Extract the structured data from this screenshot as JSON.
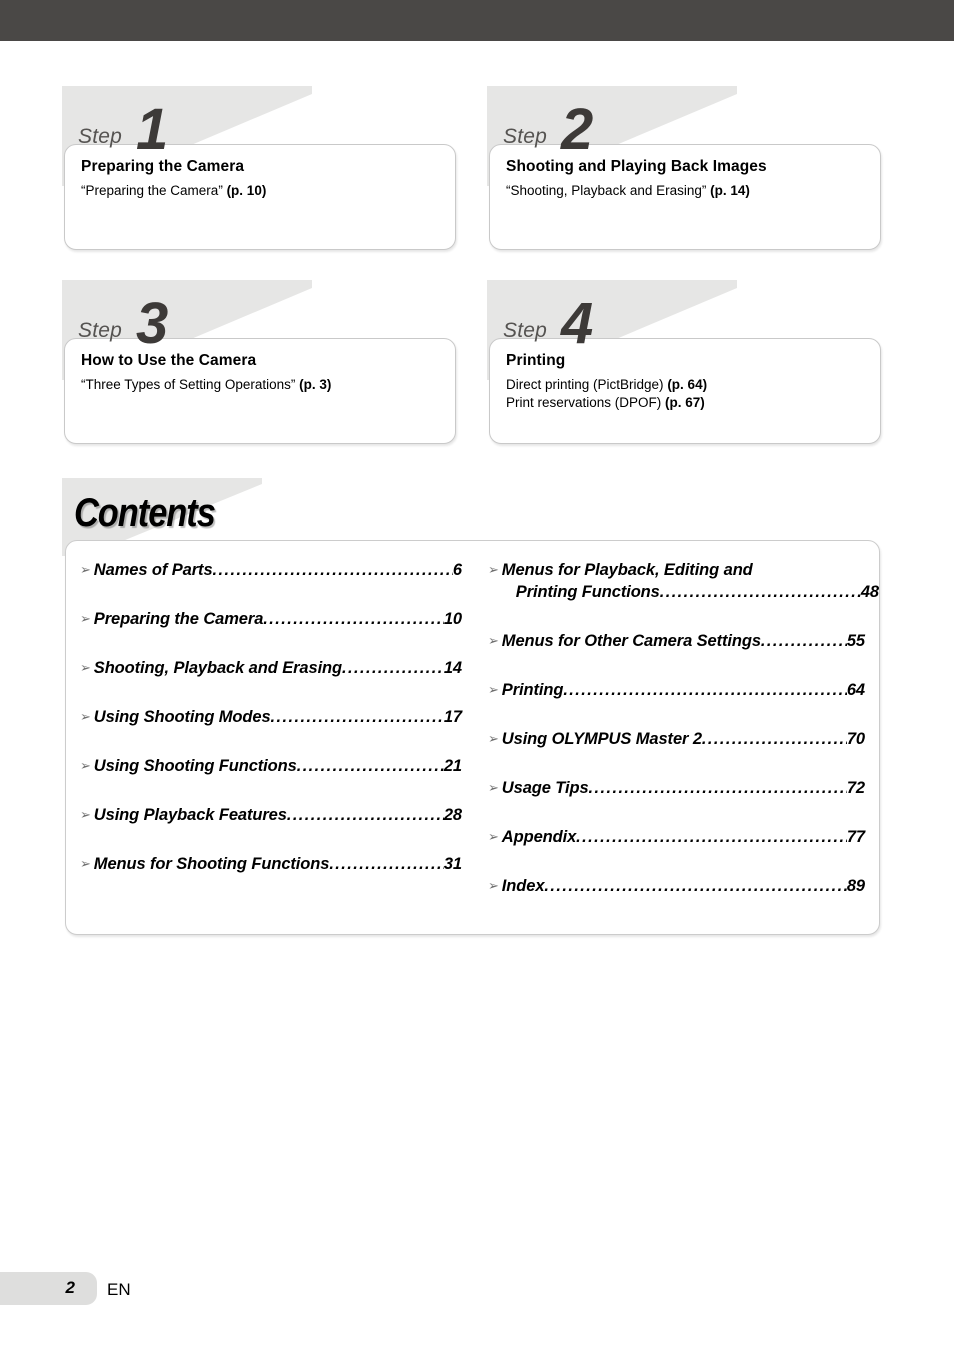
{
  "header": {
    "bar_color": "#4a4846"
  },
  "steps": [
    {
      "step_word": "Step",
      "number": "1",
      "title": "Preparing the Camera",
      "lines": [
        {
          "plain": "“Preparing the Camera” ",
          "bold": "(p. 10)"
        }
      ]
    },
    {
      "step_word": "Step",
      "number": "2",
      "title": "Shooting and Playing Back Images",
      "lines": [
        {
          "plain": "“Shooting, Playback and Erasing” ",
          "bold": "(p. 14)"
        }
      ]
    },
    {
      "step_word": "Step",
      "number": "3",
      "title": "How to Use the Camera",
      "lines": [
        {
          "plain": "“Three Types of Setting Operations” ",
          "bold": "(p. 3)"
        }
      ]
    },
    {
      "step_word": "Step",
      "number": "4",
      "title": "Printing",
      "lines": [
        {
          "plain": "Direct printing (PictBridge) ",
          "bold": "(p. 64)"
        },
        {
          "plain": "Print reservations (DPOF) ",
          "bold": "(p. 67)"
        }
      ]
    }
  ],
  "contents": {
    "heading": "Contents",
    "bullet_glyph": "➢",
    "dot_leader": "..........................................................................",
    "left_items": [
      {
        "text": "Names of Parts",
        "page": "6"
      },
      {
        "text": "Preparing the Camera",
        "page": "10"
      },
      {
        "text": "Shooting, Playback and Erasing",
        "page": "14"
      },
      {
        "text": "Using Shooting Modes",
        "page": "17"
      },
      {
        "text": "Using Shooting Functions",
        "page": "21"
      },
      {
        "text": "Using Playback Features",
        "page": "28"
      },
      {
        "text": "Menus for Shooting Functions",
        "page": "31"
      }
    ],
    "right_items": [
      {
        "text": "Menus for Playback, Editing and",
        "text2": "Printing Functions",
        "page": "48"
      },
      {
        "text": "Menus for Other Camera Settings ",
        "page": "55"
      },
      {
        "text": "Printing",
        "page": "64"
      },
      {
        "text": "Using OLYMPUS Master 2",
        "page": "70"
      },
      {
        "text": "Usage Tips ",
        "page": "72"
      },
      {
        "text": "Appendix ",
        "page": "77"
      },
      {
        "text": "Index ",
        "page": "89"
      }
    ]
  },
  "footer": {
    "page_number": "2",
    "language": "EN"
  }
}
